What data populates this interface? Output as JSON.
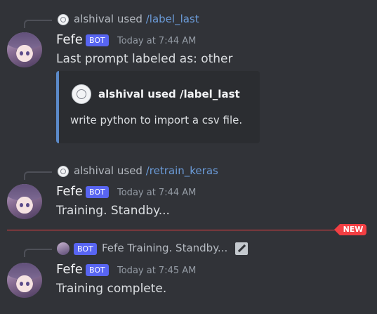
{
  "messages": [
    {
      "reply": {
        "user": "alshival",
        "used": "used",
        "command": "/label_last"
      },
      "author": "Fefe",
      "tag": "BOT",
      "time": "Today at 7:44 AM",
      "text": "Last prompt labeled as: other",
      "embed": {
        "title": "alshival  used /label_last",
        "description": "write python to import a csv file."
      }
    },
    {
      "reply": {
        "user": "alshival",
        "used": "used",
        "command": "/retrain_keras"
      },
      "author": "Fefe",
      "tag": "BOT",
      "time": "Today at 7:44 AM",
      "text": "Training. Standby..."
    },
    {
      "reply": {
        "tag": "BOT",
        "author": "Fefe",
        "text": "Training. Standby..."
      },
      "author": "Fefe",
      "tag": "BOT",
      "time": "Today at 7:45 AM",
      "text": "Training complete."
    }
  ],
  "divider": {
    "label": "NEW",
    "color": "#f23f43"
  },
  "colors": {
    "background": "#313338",
    "bot_tag": "#5865f2",
    "command_link": "#6b9bd8",
    "embed_bar": "#5b8ac9"
  },
  "icons": {
    "reply_avatar": "default-avatar-icon",
    "edited": "edit-icon"
  }
}
